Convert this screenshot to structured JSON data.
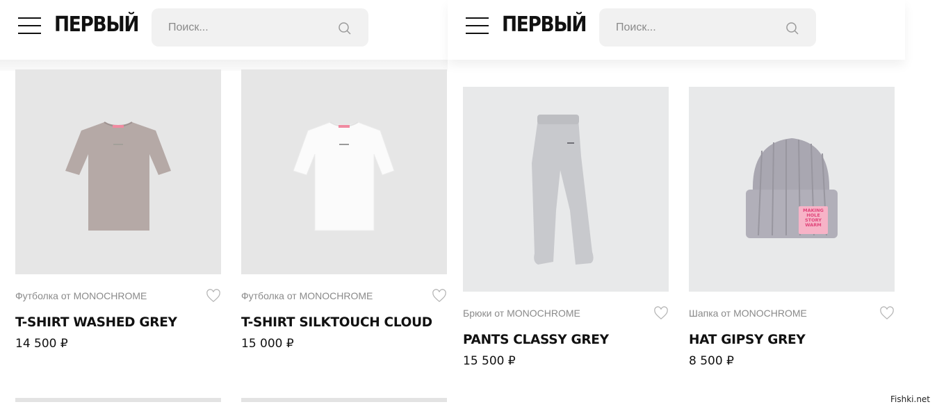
{
  "panels": [
    {
      "logo": "ПЕРВЫЙ",
      "search_placeholder": "Поиск...",
      "products": [
        {
          "category": "Футболка от MONOCHROME",
          "name": "T-SHIRT WASHED GREY",
          "price": "14 500 ₽",
          "image": "grey-tshirt",
          "image_bg": "#e6e6e6",
          "item_color": "#b5a9a6"
        },
        {
          "category": "Футболка от MONOCHROME",
          "name": "T-SHIRT SILKTOUCH CLOUD",
          "price": "15 000 ₽",
          "image": "white-tshirt",
          "image_bg": "#e6e6e6",
          "item_color": "#fbfbfb"
        }
      ]
    },
    {
      "logo": "ПЕРВЫЙ",
      "search_placeholder": "Поиск...",
      "products": [
        {
          "category": "Брюки от MONOCHROME",
          "name": "PANTS CLASSY GREY",
          "price": "15 500 ₽",
          "image": "grey-pants",
          "image_bg": "#e8e9ea",
          "item_color": "#c8c9cd"
        },
        {
          "category": "Шапка от MONOCHROME",
          "name": "HAT GIPSY GREY",
          "price": "8 500 ₽",
          "image": "grey-beanie",
          "image_bg": "#e8e9ea",
          "item_color": "#a9a7b1",
          "patch_text": [
            "MAKING",
            "HOLE",
            "STORY",
            "WARM"
          ]
        }
      ]
    }
  ],
  "watermark": "Fishki.net"
}
